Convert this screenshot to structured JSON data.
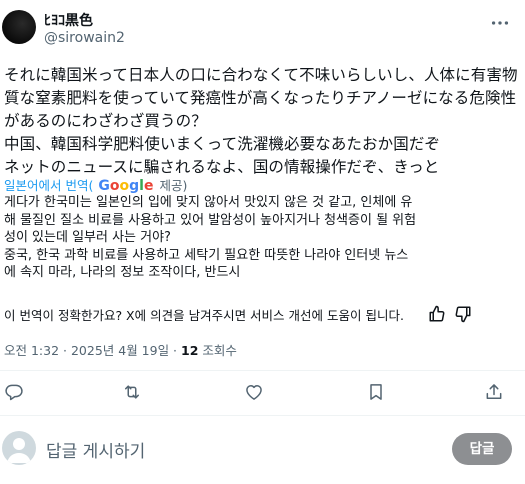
{
  "author": {
    "display_name": "ﾋﾖｺ黒色",
    "handle": "@sirowain2"
  },
  "tweet": {
    "text": "それに韓国米って日本人の口に合わなくて不味いらしいし、人体に有害物\n質な窒素肥料を使っていて発癌性が高くなったりチアノーゼになる危険性\nがあるのにわざわざ買うの？\n中国、韓国科学肥料使いまくって洗濯機必要なあたおか国だぞ\nネットのニュースに騙されるなよ、国の情報操作だぞ、きっと"
  },
  "translation": {
    "label": "일본어에서 번역",
    "by_open": "(",
    "provider": "Google",
    "provider_letters": [
      "G",
      "o",
      "o",
      "g",
      "l",
      "e"
    ],
    "service": "제공)",
    "text": "게다가 한국미는 일본인의 입에 맞지 않아서 맛있지 않은 것 같고, 인체에 유\n해 물질인 질소 비료를 사용하고 있어 발암성이 높아지거나 청색증이 될 위험\n성이 있는데 일부러 사는 거야?\n중국, 한국 과학 비료를 사용하고 세탁기 필요한 따뜻한 나라야 인터넷 뉴스\n에 속지 마라, 나라의 정보 조작이다, 반드시",
    "feedback_prompt": "이 번역이 정확한가요? X에 의견을 남겨주시면 서비스 개선에 도움이 됩니다."
  },
  "meta": {
    "time": "오전 1:32 · 2025년 4월 19일 · ",
    "views_count": "12",
    "views_label": " 조회수"
  },
  "composer": {
    "placeholder": "답글 게시하기",
    "reply_label": "답글"
  },
  "icons": {
    "more": "more-horizontal-icon",
    "reply": "reply-bubble-icon",
    "retweet": "retweet-icon",
    "like": "heart-icon",
    "bookmark": "bookmark-icon",
    "share": "share-upload-icon",
    "thumb_up": "thumbs-up-icon",
    "thumb_down": "thumbs-down-icon"
  },
  "colors": {
    "link": "#1d9bf0",
    "secondary_text": "#536471",
    "reply_button_bg": "#8d8f92"
  }
}
